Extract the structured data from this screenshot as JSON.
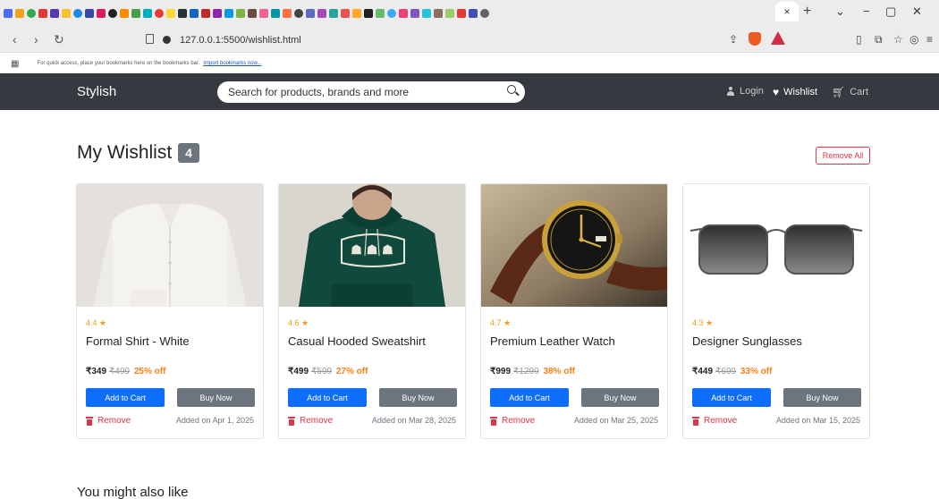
{
  "browser": {
    "url": "127.0.0.1:5500/wishlist.html",
    "bookmarks_hint": "For quick access, place your bookmarks here on the bookmarks bar.",
    "bookmarks_link": "Import bookmarks now...",
    "tab_close": "×",
    "new_tab": "+"
  },
  "header": {
    "brand": "Stylish",
    "search_placeholder": "Search for products, brands and more",
    "login": "Login",
    "wishlist": "Wishlist",
    "cart": "Cart"
  },
  "page": {
    "title": "My Wishlist",
    "count": "4",
    "remove_all": "Remove All",
    "suggestions_title": "You might also like"
  },
  "products": [
    {
      "rating": "4.4 ★",
      "name": "Formal Shirt - White",
      "price": "₹349",
      "original": "₹499",
      "discount": "25% off",
      "add_to_cart": "Add to Cart",
      "buy_now": "Buy Now",
      "remove": "Remove",
      "added": "Added on Apr 1, 2025"
    },
    {
      "rating": "4.6 ★",
      "name": "Casual Hooded Sweatshirt",
      "price": "₹499",
      "original": "₹599",
      "discount": "27% off",
      "add_to_cart": "Add to Cart",
      "buy_now": "Buy Now",
      "remove": "Remove",
      "added": "Added on Mar 28, 2025"
    },
    {
      "rating": "4.7 ★",
      "name": "Premium Leather Watch",
      "price": "₹999",
      "original": "₹1299",
      "discount": "38% off",
      "add_to_cart": "Add to Cart",
      "buy_now": "Buy Now",
      "remove": "Remove",
      "added": "Added on Mar 25, 2025"
    },
    {
      "rating": "4.3 ★",
      "name": "Designer Sunglasses",
      "price": "₹449",
      "original": "₹699",
      "discount": "33% off",
      "add_to_cart": "Add to Cart",
      "buy_now": "Buy Now",
      "remove": "Remove",
      "added": "Added on Mar 15, 2025"
    }
  ],
  "colors": {
    "header_bg": "#343a40",
    "primary": "#0d6efd",
    "secondary": "#6c757d",
    "danger": "#dc3545",
    "rating": "#f39c12",
    "discount": "#fd7e14"
  }
}
